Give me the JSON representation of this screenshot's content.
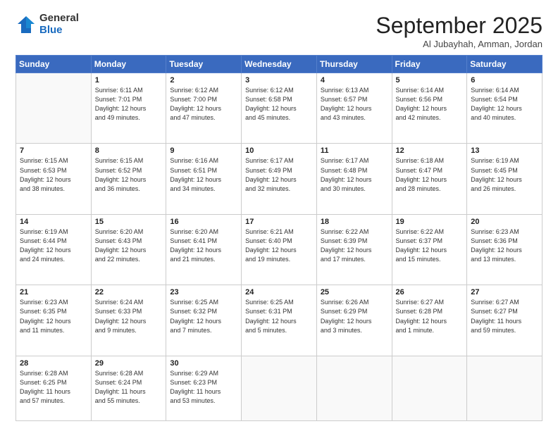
{
  "logo": {
    "general": "General",
    "blue": "Blue"
  },
  "header": {
    "month": "September 2025",
    "location": "Al Jubayhah, Amman, Jordan"
  },
  "weekdays": [
    "Sunday",
    "Monday",
    "Tuesday",
    "Wednesday",
    "Thursday",
    "Friday",
    "Saturday"
  ],
  "weeks": [
    [
      {
        "day": "",
        "content": ""
      },
      {
        "day": "1",
        "content": "Sunrise: 6:11 AM\nSunset: 7:01 PM\nDaylight: 12 hours\nand 49 minutes."
      },
      {
        "day": "2",
        "content": "Sunrise: 6:12 AM\nSunset: 7:00 PM\nDaylight: 12 hours\nand 47 minutes."
      },
      {
        "day": "3",
        "content": "Sunrise: 6:12 AM\nSunset: 6:58 PM\nDaylight: 12 hours\nand 45 minutes."
      },
      {
        "day": "4",
        "content": "Sunrise: 6:13 AM\nSunset: 6:57 PM\nDaylight: 12 hours\nand 43 minutes."
      },
      {
        "day": "5",
        "content": "Sunrise: 6:14 AM\nSunset: 6:56 PM\nDaylight: 12 hours\nand 42 minutes."
      },
      {
        "day": "6",
        "content": "Sunrise: 6:14 AM\nSunset: 6:54 PM\nDaylight: 12 hours\nand 40 minutes."
      }
    ],
    [
      {
        "day": "7",
        "content": "Sunrise: 6:15 AM\nSunset: 6:53 PM\nDaylight: 12 hours\nand 38 minutes."
      },
      {
        "day": "8",
        "content": "Sunrise: 6:15 AM\nSunset: 6:52 PM\nDaylight: 12 hours\nand 36 minutes."
      },
      {
        "day": "9",
        "content": "Sunrise: 6:16 AM\nSunset: 6:51 PM\nDaylight: 12 hours\nand 34 minutes."
      },
      {
        "day": "10",
        "content": "Sunrise: 6:17 AM\nSunset: 6:49 PM\nDaylight: 12 hours\nand 32 minutes."
      },
      {
        "day": "11",
        "content": "Sunrise: 6:17 AM\nSunset: 6:48 PM\nDaylight: 12 hours\nand 30 minutes."
      },
      {
        "day": "12",
        "content": "Sunrise: 6:18 AM\nSunset: 6:47 PM\nDaylight: 12 hours\nand 28 minutes."
      },
      {
        "day": "13",
        "content": "Sunrise: 6:19 AM\nSunset: 6:45 PM\nDaylight: 12 hours\nand 26 minutes."
      }
    ],
    [
      {
        "day": "14",
        "content": "Sunrise: 6:19 AM\nSunset: 6:44 PM\nDaylight: 12 hours\nand 24 minutes."
      },
      {
        "day": "15",
        "content": "Sunrise: 6:20 AM\nSunset: 6:43 PM\nDaylight: 12 hours\nand 22 minutes."
      },
      {
        "day": "16",
        "content": "Sunrise: 6:20 AM\nSunset: 6:41 PM\nDaylight: 12 hours\nand 21 minutes."
      },
      {
        "day": "17",
        "content": "Sunrise: 6:21 AM\nSunset: 6:40 PM\nDaylight: 12 hours\nand 19 minutes."
      },
      {
        "day": "18",
        "content": "Sunrise: 6:22 AM\nSunset: 6:39 PM\nDaylight: 12 hours\nand 17 minutes."
      },
      {
        "day": "19",
        "content": "Sunrise: 6:22 AM\nSunset: 6:37 PM\nDaylight: 12 hours\nand 15 minutes."
      },
      {
        "day": "20",
        "content": "Sunrise: 6:23 AM\nSunset: 6:36 PM\nDaylight: 12 hours\nand 13 minutes."
      }
    ],
    [
      {
        "day": "21",
        "content": "Sunrise: 6:23 AM\nSunset: 6:35 PM\nDaylight: 12 hours\nand 11 minutes."
      },
      {
        "day": "22",
        "content": "Sunrise: 6:24 AM\nSunset: 6:33 PM\nDaylight: 12 hours\nand 9 minutes."
      },
      {
        "day": "23",
        "content": "Sunrise: 6:25 AM\nSunset: 6:32 PM\nDaylight: 12 hours\nand 7 minutes."
      },
      {
        "day": "24",
        "content": "Sunrise: 6:25 AM\nSunset: 6:31 PM\nDaylight: 12 hours\nand 5 minutes."
      },
      {
        "day": "25",
        "content": "Sunrise: 6:26 AM\nSunset: 6:29 PM\nDaylight: 12 hours\nand 3 minutes."
      },
      {
        "day": "26",
        "content": "Sunrise: 6:27 AM\nSunset: 6:28 PM\nDaylight: 12 hours\nand 1 minute."
      },
      {
        "day": "27",
        "content": "Sunrise: 6:27 AM\nSunset: 6:27 PM\nDaylight: 11 hours\nand 59 minutes."
      }
    ],
    [
      {
        "day": "28",
        "content": "Sunrise: 6:28 AM\nSunset: 6:25 PM\nDaylight: 11 hours\nand 57 minutes."
      },
      {
        "day": "29",
        "content": "Sunrise: 6:28 AM\nSunset: 6:24 PM\nDaylight: 11 hours\nand 55 minutes."
      },
      {
        "day": "30",
        "content": "Sunrise: 6:29 AM\nSunset: 6:23 PM\nDaylight: 11 hours\nand 53 minutes."
      },
      {
        "day": "",
        "content": ""
      },
      {
        "day": "",
        "content": ""
      },
      {
        "day": "",
        "content": ""
      },
      {
        "day": "",
        "content": ""
      }
    ]
  ]
}
